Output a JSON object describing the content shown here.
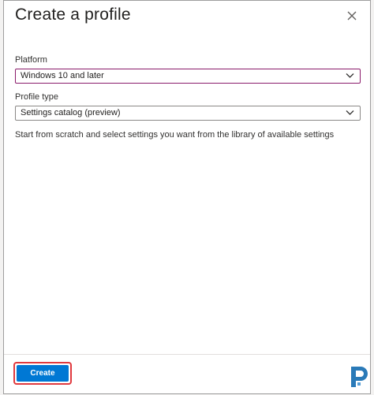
{
  "header": {
    "title": "Create a profile",
    "close_icon": "close-icon"
  },
  "form": {
    "platform": {
      "label": "Platform",
      "value": "Windows 10 and later"
    },
    "profile_type": {
      "label": "Profile type",
      "value": "Settings catalog (preview)"
    },
    "description": "Start from scratch and select settings you want from the library of available settings"
  },
  "footer": {
    "create_label": "Create"
  },
  "colors": {
    "accent": "#0078d4",
    "highlight": "#e0393e",
    "focus_border": "#8a1a6a",
    "logo": "#2a7ab8"
  }
}
